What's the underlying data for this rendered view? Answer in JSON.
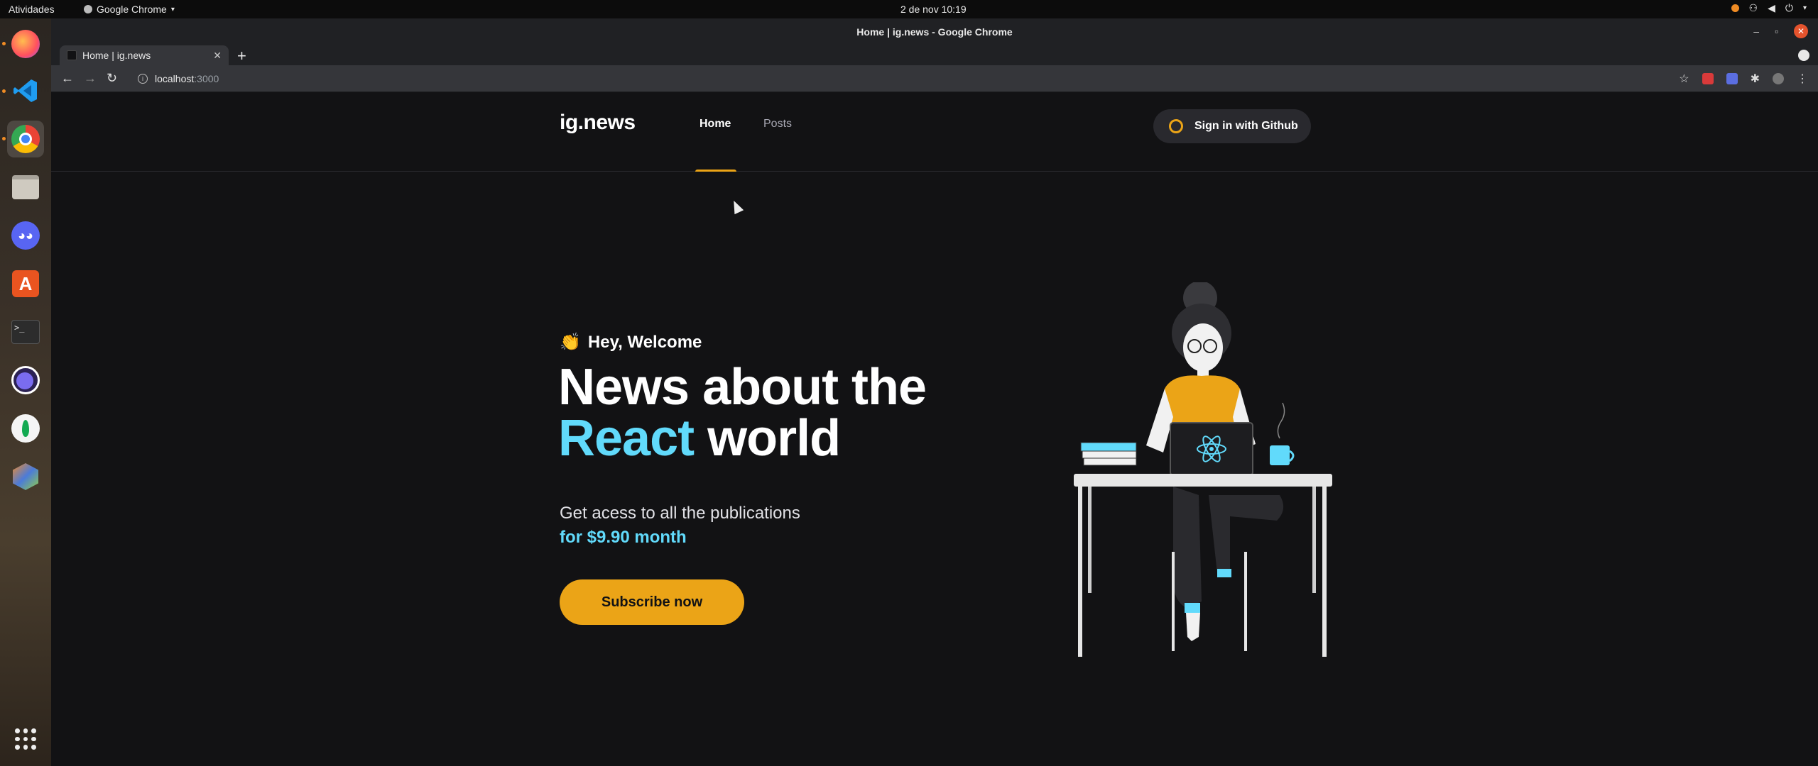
{
  "os": {
    "activities": "Atividades",
    "app_menu": "Google Chrome",
    "clock": "2 de nov  10:19"
  },
  "browser": {
    "window_title": "Home | ig.news - Google Chrome",
    "tab_title": "Home | ig.news",
    "url_host": "localhost",
    "url_port": ":3000"
  },
  "site": {
    "logo": "ig.news",
    "nav": [
      {
        "label": "Home",
        "active": true
      },
      {
        "label": "Posts",
        "active": false
      }
    ],
    "signin_label": "Sign in with Github",
    "hero": {
      "greeting_emoji": "👏",
      "greeting": "Hey, Welcome",
      "title_line1": "News about the",
      "title_accent": "React",
      "title_line2_rest": " world",
      "subtitle": "Get acess to all the publications",
      "price": "for $9.90 month",
      "cta": "Subscribe now"
    },
    "colors": {
      "background": "#121214",
      "accent_yellow": "#eba417",
      "accent_cyan": "#61dafb"
    }
  },
  "dock_apps": [
    "firefox-icon",
    "vscode-icon",
    "chrome-icon",
    "files-icon",
    "discord-icon",
    "software-center-icon",
    "terminal-icon",
    "eclipse-icon",
    "mongodb-icon",
    "app-icon",
    "show-apps-icon"
  ]
}
